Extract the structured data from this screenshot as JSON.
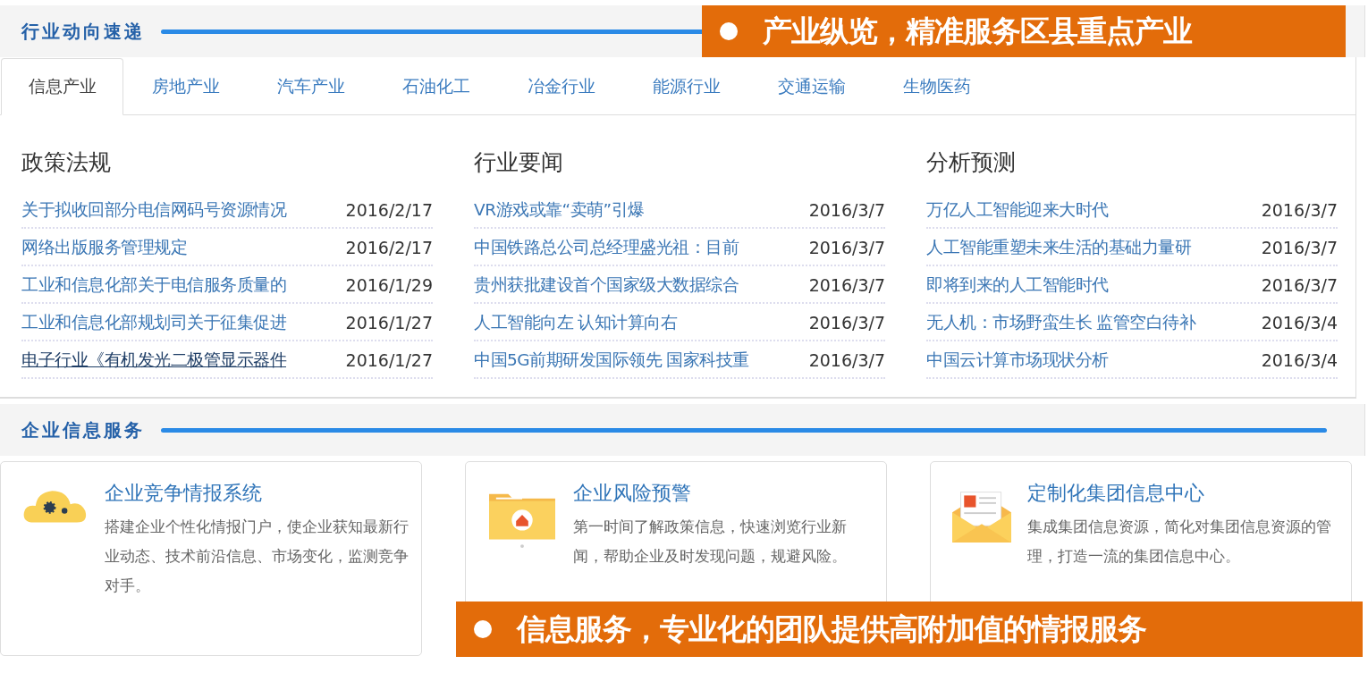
{
  "industry_section": {
    "title": "行业动向速递",
    "tabs": [
      {
        "label": "信息产业",
        "selected": true
      },
      {
        "label": "房地产业",
        "selected": false
      },
      {
        "label": "汽车产业",
        "selected": false
      },
      {
        "label": "石油化工",
        "selected": false
      },
      {
        "label": "冶金行业",
        "selected": false
      },
      {
        "label": "能源行业",
        "selected": false
      },
      {
        "label": "交通运输",
        "selected": false
      },
      {
        "label": "生物医药",
        "selected": false
      }
    ],
    "columns": [
      {
        "heading": "政策法规",
        "items": [
          {
            "title": "关于拟收回部分电信网码号资源情况",
            "date": "2016/2/17",
            "hovered": false
          },
          {
            "title": "网络出版服务管理规定",
            "date": "2016/2/17",
            "hovered": false
          },
          {
            "title": "工业和信息化部关于电信服务质量的",
            "date": "2016/1/29",
            "hovered": false
          },
          {
            "title": "工业和信息化部规划司关于征集促进",
            "date": "2016/1/27",
            "hovered": false
          },
          {
            "title": "电子行业《有机发光二极管显示器件",
            "date": "2016/1/27",
            "hovered": true
          }
        ]
      },
      {
        "heading": "行业要闻",
        "items": [
          {
            "title": "VR游戏或靠“卖萌”引爆",
            "date": "2016/3/7",
            "hovered": false
          },
          {
            "title": "中国铁路总公司总经理盛光祖：目前",
            "date": "2016/3/7",
            "hovered": false
          },
          {
            "title": "贵州获批建设首个国家级大数据综合",
            "date": "2016/3/7",
            "hovered": false
          },
          {
            "title": "人工智能向左 认知计算向右",
            "date": "2016/3/7",
            "hovered": false
          },
          {
            "title": "中国5G前期研发国际领先 国家科技重",
            "date": "2016/3/7",
            "hovered": false
          }
        ]
      },
      {
        "heading": "分析预测",
        "items": [
          {
            "title": "万亿人工智能迎来大时代",
            "date": "2016/3/7",
            "hovered": false
          },
          {
            "title": "人工智能重塑未来生活的基础力量研",
            "date": "2016/3/7",
            "hovered": false
          },
          {
            "title": "即将到来的人工智能时代",
            "date": "2016/3/7",
            "hovered": false
          },
          {
            "title": "无人机：市场野蛮生长 监管空白待补",
            "date": "2016/3/4",
            "hovered": false
          },
          {
            "title": "中国云计算市场现状分析",
            "date": "2016/3/4",
            "hovered": false
          }
        ]
      }
    ]
  },
  "service_section": {
    "title": "企业信息服务",
    "cards": [
      {
        "kind": "cloud",
        "title": "企业竞争情报系统",
        "description": "搭建企业个性化情报门户，使企业获知最新行业动态、技术前沿信息、市场变化，监测竞争对手。"
      },
      {
        "kind": "folder",
        "title": "企业风险预警",
        "description": "第一时间了解政策信息，快速浏览行业新闻，帮助企业及时发现问题，规避风险。"
      },
      {
        "kind": "envelope",
        "title": "定制化集团信息中心",
        "description": "集成集团信息资源，简化对集团信息资源的管理，打造一流的集团信息中心。"
      }
    ]
  },
  "callouts": [
    {
      "text": "产业纵览，精准服务区县重点产业"
    },
    {
      "text": "信息服务，专业化的团队提供高附加值的情报服务"
    }
  ]
}
